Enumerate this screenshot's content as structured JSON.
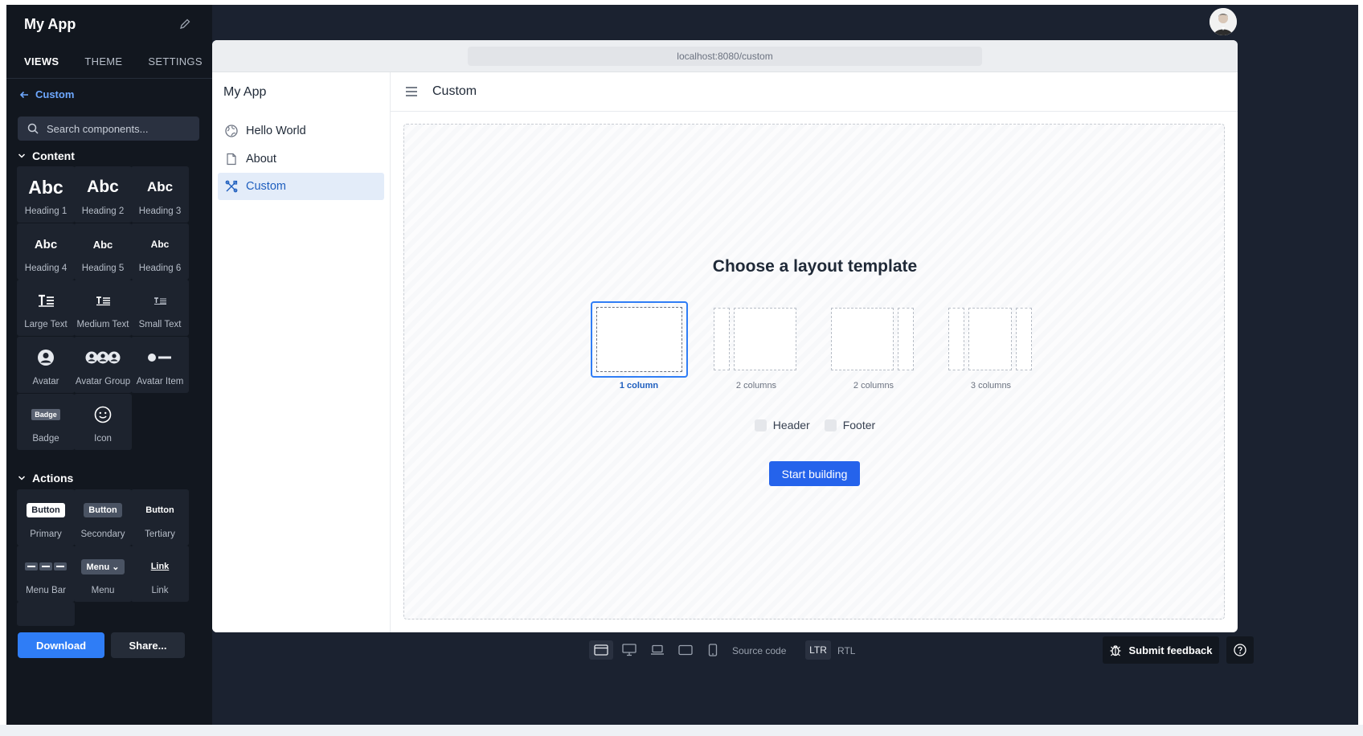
{
  "builder": {
    "title": "My App",
    "tabs": [
      "VIEWS",
      "THEME",
      "SETTINGS"
    ],
    "breadcrumb": "Custom",
    "search_placeholder": "Search components...",
    "sections": {
      "content": "Content",
      "actions": "Actions"
    },
    "content_items": [
      {
        "preview": "Abc",
        "label": "Heading 1"
      },
      {
        "preview": "Abc",
        "label": "Heading 2"
      },
      {
        "preview": "Abc",
        "label": "Heading 3"
      },
      {
        "preview": "Abc",
        "label": "Heading 4"
      },
      {
        "preview": "Abc",
        "label": "Heading 5"
      },
      {
        "preview": "Abc",
        "label": "Heading 6"
      },
      {
        "label": "Large Text",
        "icon": "large-text-icon"
      },
      {
        "label": "Medium Text",
        "icon": "medium-text-icon"
      },
      {
        "label": "Small Text",
        "icon": "small-text-icon"
      },
      {
        "label": "Avatar",
        "icon": "avatar-icon"
      },
      {
        "label": "Avatar Group",
        "icon": "avatar-group-icon"
      },
      {
        "label": "Avatar Item",
        "icon": "avatar-item-icon"
      },
      {
        "preview": "Badge",
        "label": "Badge"
      },
      {
        "label": "Icon",
        "icon": "smiley-icon"
      }
    ],
    "action_items": [
      {
        "preview": "Button",
        "label": "Primary"
      },
      {
        "preview": "Button",
        "label": "Secondary"
      },
      {
        "preview": "Button",
        "label": "Tertiary"
      },
      {
        "label": "Menu Bar",
        "icon": "menu-bar-icon"
      },
      {
        "preview": "Menu",
        "label": "Menu"
      },
      {
        "preview": "Link",
        "label": "Link"
      }
    ],
    "download_label": "Download",
    "share_label": "Share..."
  },
  "preview": {
    "url": "localhost:8080/custom",
    "app_title": "My App",
    "nav": [
      {
        "label": "Hello World",
        "icon": "globe-icon"
      },
      {
        "label": "About",
        "icon": "file-icon"
      },
      {
        "label": "Custom",
        "icon": "tools-icon",
        "active": true
      }
    ],
    "page_title": "Custom",
    "choose_title": "Choose a layout template",
    "templates": [
      {
        "label": "1 column",
        "selected": true
      },
      {
        "label": "2 columns"
      },
      {
        "label": "2 columns"
      },
      {
        "label": "3 columns"
      }
    ],
    "options": [
      "Header",
      "Footer"
    ],
    "start_label": "Start building"
  },
  "toolbar": {
    "source_code": "Source code",
    "ltr": "LTR",
    "rtl": "RTL",
    "feedback": "Submit feedback"
  },
  "colors": {
    "accent": "#2f7df6",
    "sidebar_bg": "#12171f",
    "frame_bg": "#1b2230"
  }
}
